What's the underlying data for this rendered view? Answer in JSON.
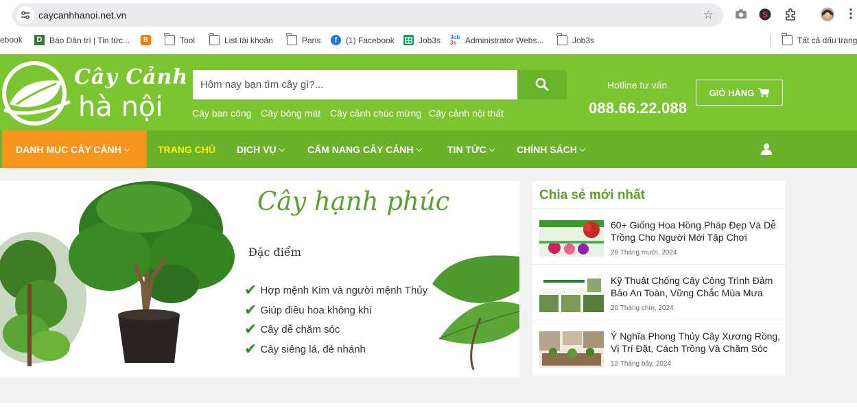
{
  "browser": {
    "url": "caycanhhanoi.net.vn",
    "bookmarks": [
      {
        "label": "ebook",
        "icon": "none"
      },
      {
        "label": "Báo Dân trí | Tin tức...",
        "icon": "dantri-icon"
      },
      {
        "label": "",
        "icon": "blogger-icon"
      },
      {
        "label": "Tool",
        "icon": "folder-icon"
      },
      {
        "label": "List tài khoản",
        "icon": "folder-icon"
      },
      {
        "label": "Paris",
        "icon": "folder-icon"
      },
      {
        "label": "(1) Facebook",
        "icon": "facebook-icon"
      },
      {
        "label": "Job3s",
        "icon": "sheets-icon"
      },
      {
        "label": "Administrator Webs...",
        "icon": "job3s-icon"
      },
      {
        "label": "Job3s",
        "icon": "folder-icon"
      },
      {
        "label": "Tất cả dấu trang",
        "icon": "folder-icon"
      }
    ]
  },
  "header": {
    "brand_line1": "Cây Cảnh",
    "brand_line2": "hà nội",
    "search_placeholder": "Hôm nay bạn tìm cây gì?...",
    "quick_links": [
      "Cây ban công",
      "Cây bóng mát",
      "Cây cảnh chúc mừng",
      "Cây cảnh nội thất"
    ],
    "hotline_label": "Hotline tư vấn",
    "hotline_number": "088.66.22.088",
    "cart_label": "GIỎ HÀNG"
  },
  "nav": {
    "category": "DANH MỤC CÂY CẢNH",
    "items": [
      "TRANG CHỦ",
      "DỊCH VỤ",
      "CẨM NANG CÂY CẢNH",
      "TIN TỨC",
      "CHÍNH SÁCH"
    ]
  },
  "banner": {
    "title": "Cây hạnh phúc",
    "subtitle": "Đặc điểm",
    "features": [
      "Hợp mệnh Kim và người mệnh Thủy",
      "Giúp điều hoa không khí",
      "Cây dễ chăm sóc",
      "Cây siêng lá, đẻ nhánh"
    ]
  },
  "sidebar": {
    "title": "Chia sẻ mới nhất",
    "posts": [
      {
        "title": "60+ Giống Hoa Hồng Pháp Đẹp Và Dễ Trồng Cho Người Mới Tập Chơi",
        "date": "28 Tháng mười, 2024"
      },
      {
        "title": "Kỹ Thuật Chống Cây Công Trình Đảm Bảo An Toàn, Vững Chắc Mùa Mưa Bão",
        "date": "20 Tháng chín, 2024"
      },
      {
        "title": "Ý Nghĩa Phong Thủy Cây Xương Rồng, Vị Trí Đặt, Cách Trồng Và Chăm Sóc",
        "date": "12 Tháng bảy, 2024"
      }
    ]
  },
  "colors": {
    "brand_green": "#7bc531",
    "nav_green": "#69b229",
    "category_orange": "#f7941d",
    "active_yellow": "#fff200",
    "heading_green": "#5aa02c"
  }
}
